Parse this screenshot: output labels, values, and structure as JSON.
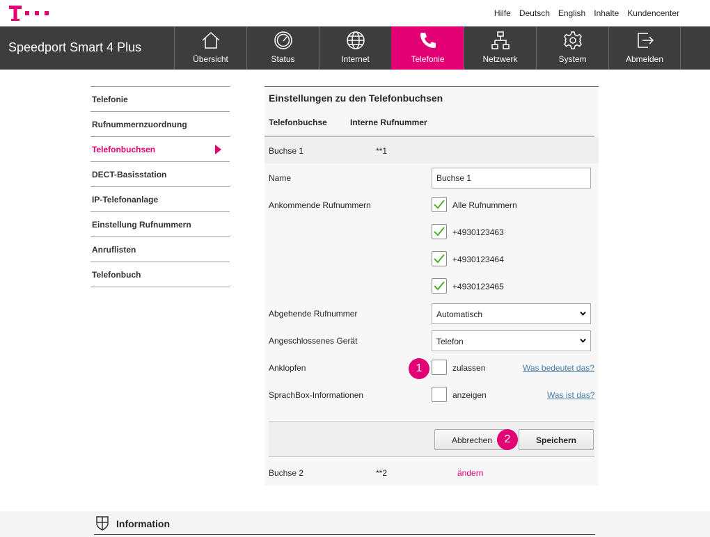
{
  "top_links": [
    "Hilfe",
    "Deutsch",
    "English",
    "Inhalte",
    "Kundencenter"
  ],
  "brand": "Speedport Smart 4 Plus",
  "nav": [
    {
      "label": "Übersicht",
      "icon": "home-icon"
    },
    {
      "label": "Status",
      "icon": "gauge-icon"
    },
    {
      "label": "Internet",
      "icon": "globe-icon"
    },
    {
      "label": "Telefonie",
      "icon": "phone-icon",
      "active": true
    },
    {
      "label": "Netzwerk",
      "icon": "network-icon"
    },
    {
      "label": "System",
      "icon": "gear-icon"
    },
    {
      "label": "Abmelden",
      "icon": "logout-icon"
    }
  ],
  "sidebar": {
    "items": [
      {
        "label": "Telefonie"
      },
      {
        "label": "Rufnummernzuordnung"
      },
      {
        "label": "Telefonbuchsen",
        "active": true
      },
      {
        "label": "DECT-Basisstation"
      },
      {
        "label": "IP-Telefonanlage"
      },
      {
        "label": "Einstellung Rufnummern"
      },
      {
        "label": "Anruflisten"
      },
      {
        "label": "Telefonbuch"
      }
    ]
  },
  "panel": {
    "title": "Einstellungen zu den Telefonbuchsen",
    "col_headers": [
      "Telefonbuchse",
      "Interne Rufnummer"
    ],
    "socket1": {
      "label": "Buchse 1",
      "number": "**1"
    },
    "name_label": "Name",
    "name_value": "Buchse 1",
    "incoming_label": "Ankommende Rufnummern",
    "incoming_options": [
      {
        "label": "Alle Rufnummern",
        "checked": true
      },
      {
        "label": "+4930123463",
        "checked": true
      },
      {
        "label": "+4930123464",
        "checked": true
      },
      {
        "label": "+4930123465",
        "checked": true
      }
    ],
    "outgoing_label": "Abgehende Rufnummer",
    "outgoing_value": "Automatisch",
    "device_label": "Angeschlossenes Gerät",
    "device_value": "Telefon",
    "callwaiting_label": "Anklopfen",
    "callwaiting_option": "zulassen",
    "callwaiting_checked": false,
    "callwaiting_help": "Was bedeutet das?",
    "voicebox_label": "SprachBox-Informationen",
    "voicebox_option": "anzeigen",
    "voicebox_checked": false,
    "voicebox_help": "Was ist das?",
    "cancel_label": "Abbrechen",
    "save_label": "Speichern",
    "socket2": {
      "label": "Buchse 2",
      "number": "**2",
      "action": "ändern"
    }
  },
  "badges": [
    "1",
    "2"
  ],
  "footer": {
    "title": "Information"
  },
  "colors": {
    "accent": "#e20074",
    "navbar": "#3d3d3d",
    "check": "#4caf2a",
    "link": "#4a7fa8"
  }
}
